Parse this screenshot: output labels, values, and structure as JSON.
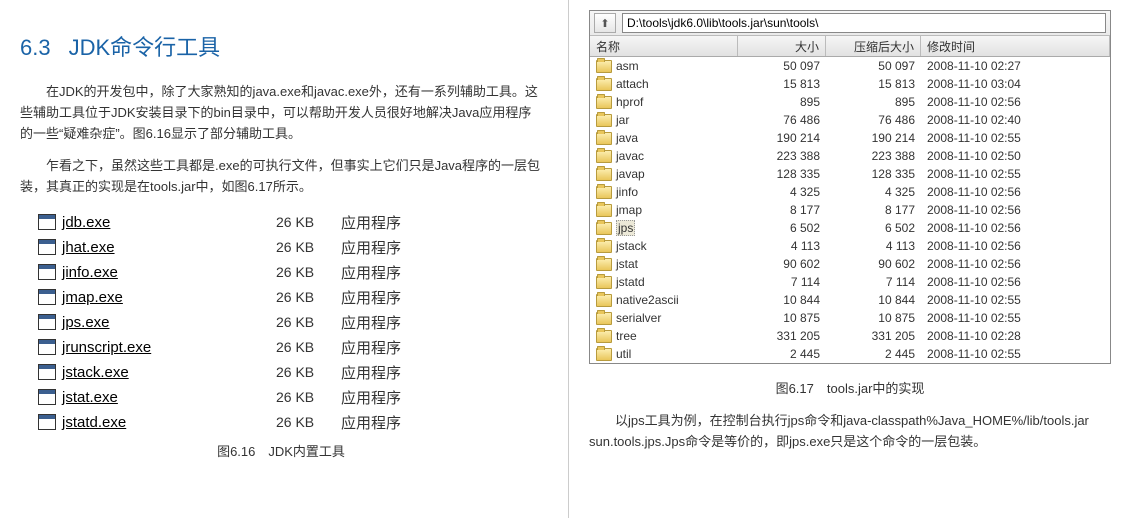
{
  "left": {
    "section_no": "6.3",
    "section_title": "JDK命令行工具",
    "para1": "在JDK的开发包中，除了大家熟知的java.exe和javac.exe外，还有一系列辅助工具。这些辅助工具位于JDK安装目录下的bin目录中，可以帮助开发人员很好地解决Java应用程序的一些“疑难杂症”。图6.16显示了部分辅助工具。",
    "para2": "乍看之下，虽然这些工具都是.exe的可执行文件，但事实上它们只是Java程序的一层包装，其真正的实现是在tools.jar中，如图6.17所示。",
    "files": [
      {
        "name": "jdb.exe",
        "size": "26 KB",
        "type": "应用程序"
      },
      {
        "name": "jhat.exe",
        "size": "26 KB",
        "type": "应用程序"
      },
      {
        "name": "jinfo.exe",
        "size": "26 KB",
        "type": "应用程序"
      },
      {
        "name": "jmap.exe",
        "size": "26 KB",
        "type": "应用程序"
      },
      {
        "name": "jps.exe",
        "size": "26 KB",
        "type": "应用程序"
      },
      {
        "name": "jrunscript.exe",
        "size": "26 KB",
        "type": "应用程序"
      },
      {
        "name": "jstack.exe",
        "size": "26 KB",
        "type": "应用程序"
      },
      {
        "name": "jstat.exe",
        "size": "26 KB",
        "type": "应用程序"
      },
      {
        "name": "jstatd.exe",
        "size": "26 KB",
        "type": "应用程序"
      }
    ],
    "caption": "图6.16　JDK内置工具"
  },
  "right": {
    "path": "D:\\tools\\jdk6.0\\lib\\tools.jar\\sun\\tools\\",
    "header": {
      "name": "名称",
      "size": "大小",
      "csize": "压缩后大小",
      "mtime": "修改时间"
    },
    "rows": [
      {
        "name": "asm",
        "size": "50 097",
        "csize": "50 097",
        "mtime": "2008-11-10 02:27"
      },
      {
        "name": "attach",
        "size": "15 813",
        "csize": "15 813",
        "mtime": "2008-11-10 03:04"
      },
      {
        "name": "hprof",
        "size": "895",
        "csize": "895",
        "mtime": "2008-11-10 02:56"
      },
      {
        "name": "jar",
        "size": "76 486",
        "csize": "76 486",
        "mtime": "2008-11-10 02:40"
      },
      {
        "name": "java",
        "size": "190 214",
        "csize": "190 214",
        "mtime": "2008-11-10 02:55"
      },
      {
        "name": "javac",
        "size": "223 388",
        "csize": "223 388",
        "mtime": "2008-11-10 02:50"
      },
      {
        "name": "javap",
        "size": "128 335",
        "csize": "128 335",
        "mtime": "2008-11-10 02:55"
      },
      {
        "name": "jinfo",
        "size": "4 325",
        "csize": "4 325",
        "mtime": "2008-11-10 02:56"
      },
      {
        "name": "jmap",
        "size": "8 177",
        "csize": "8 177",
        "mtime": "2008-11-10 02:56"
      },
      {
        "name": "jps",
        "size": "6 502",
        "csize": "6 502",
        "mtime": "2008-11-10 02:56",
        "selected": true
      },
      {
        "name": "jstack",
        "size": "4 113",
        "csize": "4 113",
        "mtime": "2008-11-10 02:56"
      },
      {
        "name": "jstat",
        "size": "90 602",
        "csize": "90 602",
        "mtime": "2008-11-10 02:56"
      },
      {
        "name": "jstatd",
        "size": "7 114",
        "csize": "7 114",
        "mtime": "2008-11-10 02:56"
      },
      {
        "name": "native2ascii",
        "size": "10 844",
        "csize": "10 844",
        "mtime": "2008-11-10 02:55"
      },
      {
        "name": "serialver",
        "size": "10 875",
        "csize": "10 875",
        "mtime": "2008-11-10 02:55"
      },
      {
        "name": "tree",
        "size": "331 205",
        "csize": "331 205",
        "mtime": "2008-11-10 02:28"
      },
      {
        "name": "util",
        "size": "2 445",
        "csize": "2 445",
        "mtime": "2008-11-10 02:55"
      }
    ],
    "caption": "图6.17　tools.jar中的实现",
    "para": "以jps工具为例，在控制台执行jps命令和java-classpath%Java_HOME%/lib/tools.jar sun.tools.jps.Jps命令是等价的，即jps.exe只是这个命令的一层包装。"
  }
}
